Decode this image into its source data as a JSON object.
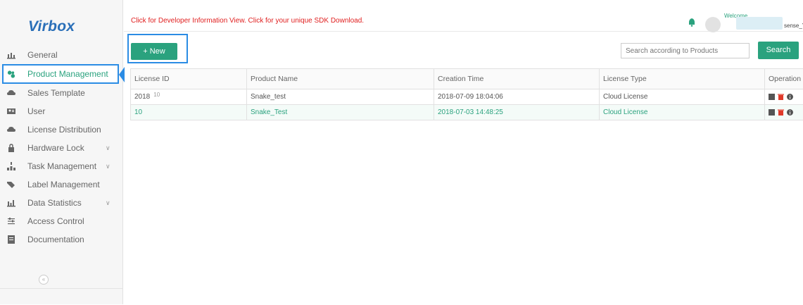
{
  "brand": {
    "name": "Virbox",
    "accent": "#2aa27e",
    "highlight": "#2b8ce4",
    "notice_color": "#e02020"
  },
  "sidebar": {
    "items": [
      {
        "label": "General",
        "icon": "chart-icon",
        "expandable": false,
        "active": false
      },
      {
        "label": "Product Management",
        "icon": "product-icon",
        "expandable": false,
        "active": true
      },
      {
        "label": "Sales Template",
        "icon": "cloud-icon",
        "expandable": false,
        "active": false
      },
      {
        "label": "User",
        "icon": "user-card-icon",
        "expandable": false,
        "active": false
      },
      {
        "label": "License Distribution",
        "icon": "cloud-icon",
        "expandable": false,
        "active": false
      },
      {
        "label": "Hardware Lock",
        "icon": "lock-icon",
        "expandable": true,
        "active": false
      },
      {
        "label": "Task Management",
        "icon": "task-icon",
        "expandable": true,
        "active": false
      },
      {
        "label": "Label Management",
        "icon": "tag-icon",
        "expandable": false,
        "active": false
      },
      {
        "label": "Data Statistics",
        "icon": "bar-chart-icon",
        "expandable": true,
        "active": false
      },
      {
        "label": "Access Control",
        "icon": "sliders-icon",
        "expandable": false,
        "active": false
      },
      {
        "label": "Documentation",
        "icon": "document-icon",
        "expandable": false,
        "active": false
      }
    ],
    "chevron": "∨",
    "collapse_label": "«"
  },
  "header": {
    "notice": "Click for Developer Information View. Click for your unique SDK Download.",
    "welcome": "Welcome",
    "username_visible": "sense_Y"
  },
  "toolbar": {
    "new_label": "+ New",
    "search_placeholder": "Search according to Products",
    "search_label": "Search"
  },
  "table": {
    "columns": [
      "License ID",
      "Product Name",
      "Creation Time",
      "License Type",
      "Operation"
    ],
    "rows": [
      {
        "license_id": "2018",
        "license_id_sup": "10",
        "product": "Snake_test",
        "created": "2018-07-09 18:04:06",
        "type": "Cloud License",
        "highlighted": false
      },
      {
        "license_id": "10",
        "license_id_sup": "",
        "product": "Snake_Test",
        "created": "2018-07-03 14:48:25",
        "type": "Cloud License",
        "highlighted": true
      }
    ]
  }
}
